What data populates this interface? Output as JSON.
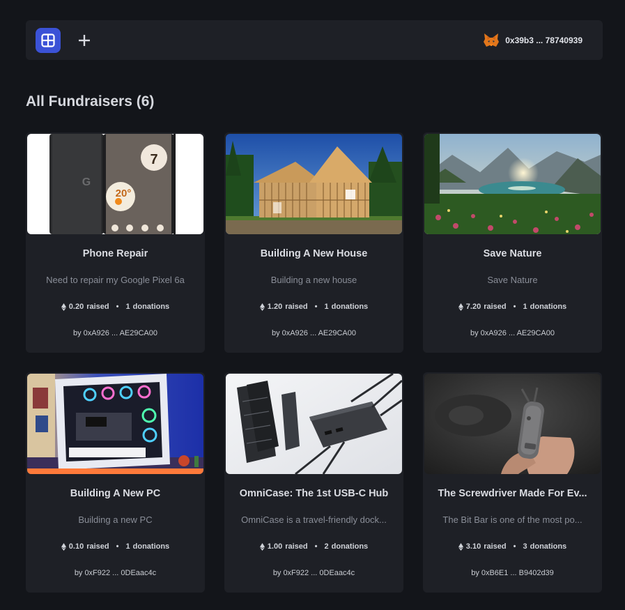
{
  "header": {
    "wallet_address": "0x39b3 ... 78740939",
    "icons": {
      "grid": "grid-view-icon",
      "plus": "plus-icon",
      "wallet": "metamask-fox-icon"
    },
    "accent_color": "#3b52d6"
  },
  "page": {
    "title": "All Fundraisers (6)"
  },
  "labels": {
    "raised": "raised",
    "donations": "donations",
    "by": "by",
    "separator": "•"
  },
  "fundraisers": [
    {
      "title": "Phone Repair",
      "description": "Need to repair my Google Pixel 6a",
      "amount": "0.20",
      "donations": "1",
      "owner": "0xA926 ... AE29CA00"
    },
    {
      "title": "Building A New House",
      "description": "Building a new house",
      "amount": "1.20",
      "donations": "1",
      "owner": "0xA926 ... AE29CA00"
    },
    {
      "title": "Save Nature",
      "description": "Save Nature",
      "amount": "7.20",
      "donations": "1",
      "owner": "0xA926 ... AE29CA00"
    },
    {
      "title": "Building A New PC",
      "description": "Building a new PC",
      "amount": "0.10",
      "donations": "1",
      "owner": "0xF922 ... 0DEaac4c"
    },
    {
      "title": "OmniCase: The 1st USB-C Hub",
      "description": "OmniCase is a travel-friendly dock...",
      "amount": "1.00",
      "donations": "2",
      "owner": "0xF922 ... 0DEaac4c"
    },
    {
      "title": "The Screwdriver Made For Ev...",
      "description": "The Bit Bar is one of the most po...",
      "amount": "3.10",
      "donations": "3",
      "owner": "0xB6E1 ... B9402d39"
    }
  ]
}
